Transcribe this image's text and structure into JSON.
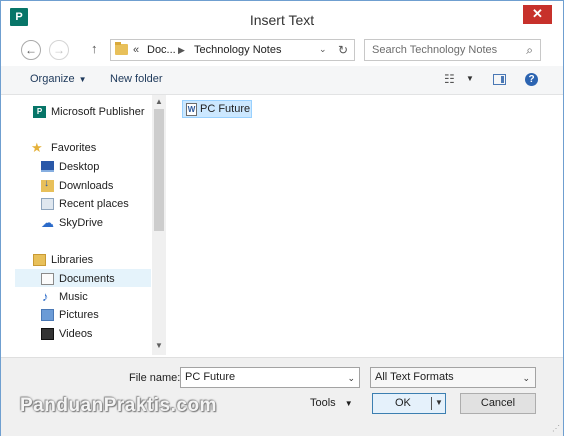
{
  "window": {
    "title": "Insert Text",
    "close_glyph": "✕",
    "app_icon_letter": "P"
  },
  "nav": {
    "back_glyph": "←",
    "forward_glyph": "→",
    "up_glyph": "↑",
    "address_prefix": "«",
    "breadcrumbs": [
      "Doc...",
      "Technology Notes"
    ],
    "crumb_separator": "▶",
    "dropdown_glyph": "⌄",
    "refresh_glyph": "↻",
    "search_placeholder": "Search Technology Notes",
    "search_glyph": "⌕"
  },
  "toolbar": {
    "organize_label": "Organize",
    "caret": "▼",
    "new_folder_label": "New folder",
    "views_glyph": "☷",
    "help_glyph": "?"
  },
  "sidebar": {
    "items": [
      {
        "label": "Microsoft Publisher",
        "icon": "publisher-icon"
      },
      {
        "label": "Favorites",
        "icon": "star-icon"
      },
      {
        "label": "Desktop",
        "icon": "desktop-icon"
      },
      {
        "label": "Downloads",
        "icon": "downloads-icon"
      },
      {
        "label": "Recent places",
        "icon": "recent-places-icon"
      },
      {
        "label": "SkyDrive",
        "icon": "skydrive-icon"
      },
      {
        "label": "Libraries",
        "icon": "libraries-icon"
      },
      {
        "label": "Documents",
        "icon": "documents-icon",
        "selected": true
      },
      {
        "label": "Music",
        "icon": "music-icon"
      },
      {
        "label": "Pictures",
        "icon": "pictures-icon"
      },
      {
        "label": "Videos",
        "icon": "videos-icon"
      }
    ],
    "star_glyph": "★",
    "cloud_glyph": "☁",
    "note_glyph": "♪"
  },
  "scrollbar": {
    "up_glyph": "▲",
    "down_glyph": "▼"
  },
  "files": [
    {
      "name": "PC Future",
      "icon": "word-document-icon",
      "icon_letter": "W"
    }
  ],
  "bottom": {
    "file_name_label": "File name:",
    "file_name_value": "PC Future",
    "filter_value": "All Text Formats",
    "tools_label": "Tools",
    "ok_label": "OK",
    "cancel_label": "Cancel",
    "grip_glyph": "⋰"
  },
  "watermark": "PanduanPraktis.com",
  "colors": {
    "accent": "#2c64b1",
    "selection": "#cce8ff",
    "close": "#c7312b",
    "publisher": "#077568"
  }
}
